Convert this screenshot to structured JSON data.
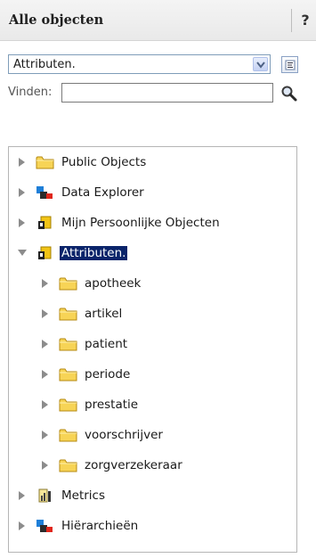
{
  "header": {
    "title": "Alle objecten",
    "help_label": "?"
  },
  "selector": {
    "value": "Attributen."
  },
  "find": {
    "label": "Vinden:",
    "value": ""
  },
  "tree": {
    "public_objects": "Public Objects",
    "data_explorer": "Data Explorer",
    "mijn_objecten": "Mijn Persoonlijke Objecten",
    "attributen": "Attributen.",
    "children": [
      "apotheek",
      "artikel",
      "patient",
      "periode",
      "prestatie",
      "voorschrijver",
      "zorgverzekeraar"
    ],
    "metrics": "Metrics",
    "hierarchieen": "Hiërarchieën"
  },
  "colors": {
    "selection": "#0a246a",
    "folder": "#f7d456",
    "header_bg": "#ececec"
  }
}
